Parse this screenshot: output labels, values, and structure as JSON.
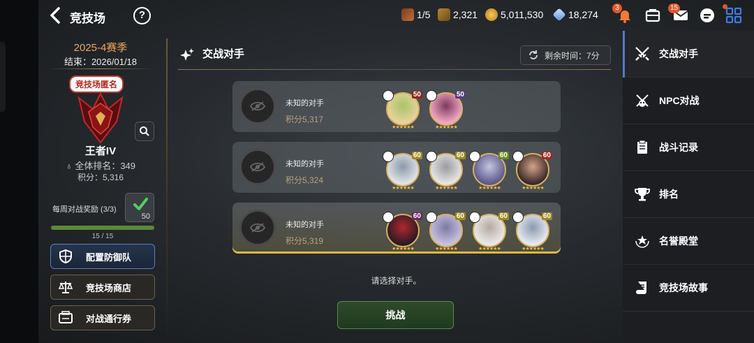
{
  "header": {
    "title": "竞技场",
    "help_label": "?",
    "resources": [
      {
        "icon": "arena-ticket-icon",
        "value": "1/5"
      },
      {
        "icon": "rank-medal-icon",
        "value": "2,321"
      },
      {
        "icon": "gold-coin-icon",
        "value": "5,011,530"
      },
      {
        "icon": "crystal-icon",
        "value": "18,274"
      }
    ],
    "notification_badge": "3",
    "mail_badge": "15"
  },
  "left": {
    "season": "2025-4赛季",
    "season_end": "结束：2026/01/18",
    "anonymous_tag": "竞技场匿名",
    "rank_name": "王者IV",
    "global_rank": "全体排名：349",
    "score": "积分：5,316",
    "weekly_reward": "每周对战奖励 (3/3)",
    "reward_count": "50",
    "progress_text": "15 / 15",
    "progress_fraction": 1.0,
    "buttons": [
      {
        "label": "配置防御队",
        "icon": "shield-icon"
      },
      {
        "label": "竞技场商店",
        "icon": "scale-icon"
      },
      {
        "label": "对战通行券",
        "icon": "pass-icon"
      }
    ]
  },
  "main": {
    "section_title": "交战对手",
    "timer": "剩余时间：7分",
    "opponents": [
      {
        "name": "未知的对手",
        "points": "积分5,317",
        "heroes": [
          {
            "level": "50",
            "colors": [
              "#e8d39a",
              "#a8c46a"
            ],
            "level_color": "#8a2a22"
          },
          {
            "level": "50",
            "colors": [
              "#f2a7c3",
              "#7a3b5f"
            ],
            "level_color": "#5a3a80"
          }
        ]
      },
      {
        "name": "未知的对手",
        "points": "积分5,324",
        "heroes": [
          {
            "level": "60",
            "colors": [
              "#dfe3ea",
              "#8c99a8"
            ],
            "level_color": "#9a8a20"
          },
          {
            "level": "60",
            "colors": [
              "#e6e6e6",
              "#9a9aa0"
            ],
            "level_color": "#9a8a20"
          },
          {
            "level": "60",
            "colors": [
              "#5b5a8a",
              "#c4c4e0"
            ],
            "level_color": "#6a8a20"
          },
          {
            "level": "60",
            "colors": [
              "#3a2a2a",
              "#d6a38a"
            ],
            "level_color": "#a02a22"
          }
        ]
      },
      {
        "name": "未知的对手",
        "points": "积分5,319",
        "heroes": [
          {
            "level": "60",
            "colors": [
              "#2a1b25",
              "#b3262e"
            ],
            "level_color": "#6a2a60"
          },
          {
            "level": "60",
            "colors": [
              "#c8c0e0",
              "#7a7aa0"
            ],
            "level_color": "#9a8a20"
          },
          {
            "level": "60",
            "colors": [
              "#eaeaea",
              "#b6a9a0"
            ],
            "level_color": "#9a8a20"
          },
          {
            "level": "60",
            "colors": [
              "#e7eaf0",
              "#8a9ab0"
            ],
            "level_color": "#9a8a20"
          }
        ]
      }
    ],
    "choose_text": "请选择对手。",
    "challenge_label": "挑战"
  },
  "sidebar": {
    "items": [
      {
        "label": "交战对手",
        "icon": "crossed-swords-icon"
      },
      {
        "label": "NPC对战",
        "icon": "npc-battle-icon"
      },
      {
        "label": "战斗记录",
        "icon": "record-icon"
      },
      {
        "label": "排名",
        "icon": "trophy-icon"
      },
      {
        "label": "名誉殿堂",
        "icon": "hall-of-fame-icon"
      },
      {
        "label": "竞技场故事",
        "icon": "story-scroll-icon"
      }
    ]
  },
  "colors": {
    "accent_blue": "#4d7ad6",
    "gold": "#d8b05c",
    "season_orange": "#f0a35e"
  }
}
